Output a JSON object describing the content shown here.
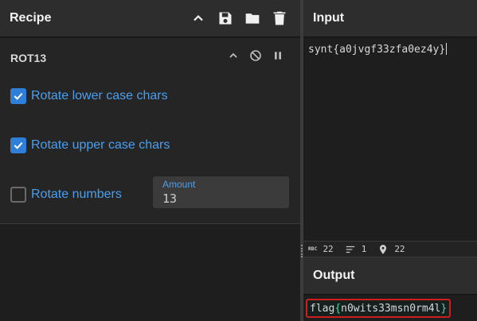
{
  "recipe": {
    "title": "Recipe",
    "icons": [
      "chevron-up-icon",
      "save-icon",
      "folder-icon",
      "trash-icon"
    ]
  },
  "operation": {
    "name": "ROT13",
    "icons": [
      "chevron-up-icon",
      "disable-icon",
      "pause-icon"
    ],
    "args": [
      {
        "label": "Rotate lower case chars",
        "checked": true
      },
      {
        "label": "Rotate upper case chars",
        "checked": true
      },
      {
        "label": "Rotate numbers",
        "checked": false
      }
    ],
    "amount": {
      "label": "Amount",
      "value": "13"
    }
  },
  "input": {
    "title": "Input",
    "text": "synt{a0jvgf33zfa0ez4y}"
  },
  "status": {
    "length_badge": "RBC",
    "length": "22",
    "lines": "1",
    "position": "22"
  },
  "output": {
    "title": "Output",
    "prefix": "flag",
    "open_brace": "{",
    "body": "n0wits33msn0rm4l",
    "close_brace": "}"
  },
  "colors": {
    "accent": "#2f7fd8",
    "label_blue": "#4a9ff0",
    "highlight_border": "#d21d1d",
    "brace_green": "#4fd6a0"
  }
}
